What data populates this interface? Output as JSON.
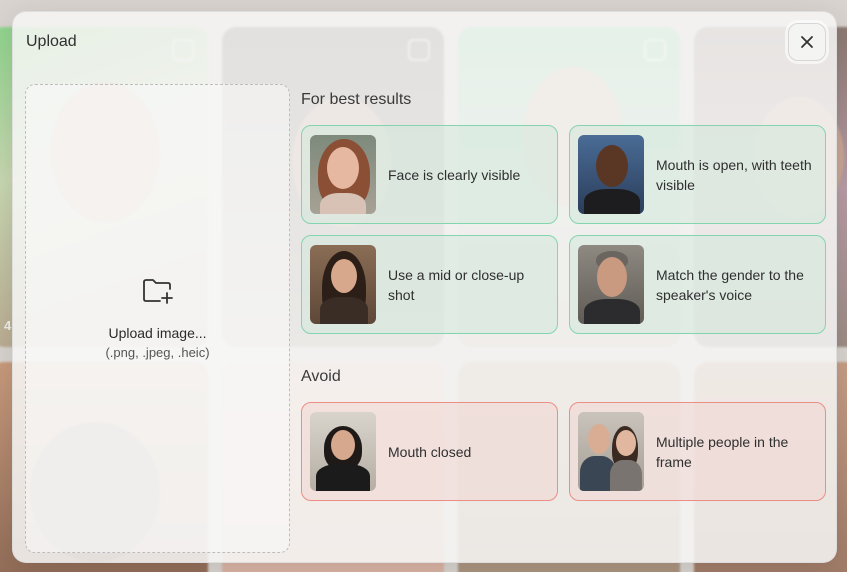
{
  "modal": {
    "title": "Upload",
    "close_icon": "close-icon"
  },
  "background": {
    "count_label": "4"
  },
  "dropzone": {
    "icon": "folder-plus-icon",
    "label": "Upload image...",
    "formats": "(.png, .jpeg, .heic)"
  },
  "best_results": {
    "title": "For best results",
    "cards": [
      {
        "text": "Face is clearly visible"
      },
      {
        "text": "Mouth is open, with teeth visible"
      },
      {
        "text": "Use a mid or close-up shot"
      },
      {
        "text": "Match the gender to the speaker's voice"
      }
    ]
  },
  "avoid": {
    "title": "Avoid",
    "cards": [
      {
        "text": "Mouth closed"
      },
      {
        "text": "Multiple people in the frame"
      }
    ]
  },
  "colors": {
    "good_border": "#84d4ae",
    "bad_border": "#ea8e86"
  }
}
